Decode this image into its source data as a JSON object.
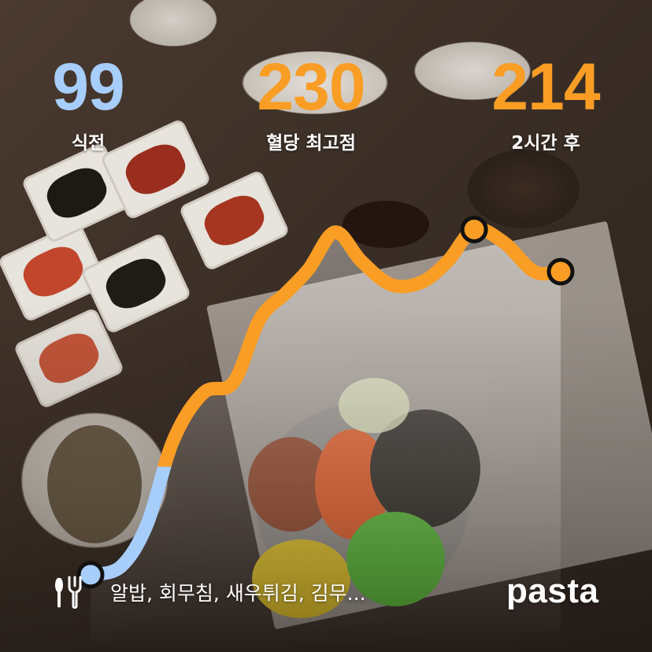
{
  "colors": {
    "before": "#a7cdfa",
    "peak": "#f99d25",
    "after": "#f99d25",
    "line_rise": "#a7cdfa",
    "line_high": "#f99d25",
    "marker_ring": "#111111"
  },
  "stats": {
    "before": {
      "value": "99",
      "label": "식전"
    },
    "peak": {
      "value": "230",
      "label": "혈당 최고점"
    },
    "after": {
      "value": "214",
      "label": "2시간 후"
    }
  },
  "chart_data": {
    "type": "line",
    "title": "",
    "xlabel": "",
    "ylabel": "",
    "x_minutes": [
      0,
      8,
      15,
      22,
      30,
      38,
      45,
      52,
      58,
      65,
      72,
      80,
      88,
      95,
      102,
      110,
      118,
      125
    ],
    "y_mgdl": [
      99,
      102,
      118,
      150,
      168,
      172,
      196,
      206,
      215,
      229,
      218,
      209,
      210,
      218,
      230,
      225,
      214,
      214
    ],
    "markers": [
      {
        "x_minutes": 0,
        "y_mgdl": 99,
        "label": "식전"
      },
      {
        "x_minutes": 102,
        "y_mgdl": 230,
        "label": "혈당 최고점"
      },
      {
        "x_minutes": 125,
        "y_mgdl": 214,
        "label": "2시간 후"
      }
    ],
    "threshold_mgdl": 140,
    "xlim": [
      0,
      125
    ],
    "ylim": [
      90,
      240
    ]
  },
  "meal": {
    "icon": "fork-knife-icon",
    "items": "알밥, 회무침, 새우튀김, 김무..."
  },
  "brand": {
    "name": "pasta"
  }
}
